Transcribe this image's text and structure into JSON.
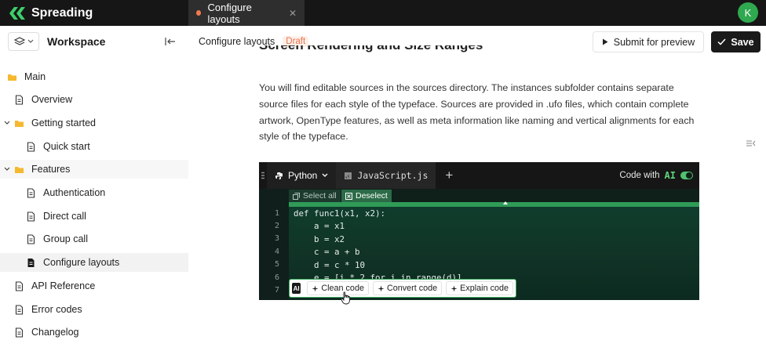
{
  "app": {
    "name": "Spreading",
    "avatar_initial": "K"
  },
  "tab": {
    "label": "Configure layouts",
    "close_glyph": "✕"
  },
  "sidebar": {
    "title": "Workspace",
    "items": [
      {
        "label": "Main",
        "icon": "folder-icon"
      },
      {
        "label": "Overview",
        "icon": "document-icon"
      },
      {
        "label": "Getting started",
        "icon": "folder-icon"
      },
      {
        "label": "Quick start",
        "icon": "document-icon"
      },
      {
        "label": "Features",
        "icon": "folder-icon"
      },
      {
        "label": "Authentication",
        "icon": "document-icon"
      },
      {
        "label": "Direct call",
        "icon": "document-icon"
      },
      {
        "label": "Group call",
        "icon": "document-icon"
      },
      {
        "label": "Configure layouts",
        "icon": "document-filled-icon"
      },
      {
        "label": "API Reference",
        "icon": "document-icon"
      },
      {
        "label": "Error codes",
        "icon": "document-icon"
      },
      {
        "label": "Changelog",
        "icon": "document-icon"
      }
    ]
  },
  "header": {
    "breadcrumb": "Configure layouts",
    "status": "Draft",
    "preview_label": "Submit for preview",
    "save_label": "Save"
  },
  "content": {
    "heading": "Screen Rendering and Size Ranges",
    "paragraph": "You will find editable sources in the sources directory. The instances subfolder contains separate source files for each style of the typeface. Sources are provided in .ufo files, which contain complete artwork, OpenType features, as well as meta information like naming and vertical alignments for each style of the typeface."
  },
  "code_panel": {
    "tabs": [
      {
        "label": "Python"
      },
      {
        "label": "JavaScript.js"
      }
    ],
    "code_with_label": "Code with",
    "ai_label": "AI",
    "select_all": "Select all",
    "deselect": "Deselect",
    "line_numbers": [
      "1",
      "2",
      "3",
      "4",
      "5",
      "6",
      "7"
    ],
    "lines": [
      "def func1(x1, x2):",
      "    a = x1",
      "    b = x2",
      "    c = a + b",
      "    d = c * 10",
      "    e = [i * 2 for i in range(d)]"
    ],
    "ai_actions": {
      "badge": "AI",
      "clean": "Clean code",
      "convert": "Convert code",
      "explain": "Explain code"
    }
  },
  "colors": {
    "accent_green": "#2f9b57",
    "draft_orange": "#e8754c",
    "topbar": "#161616"
  }
}
